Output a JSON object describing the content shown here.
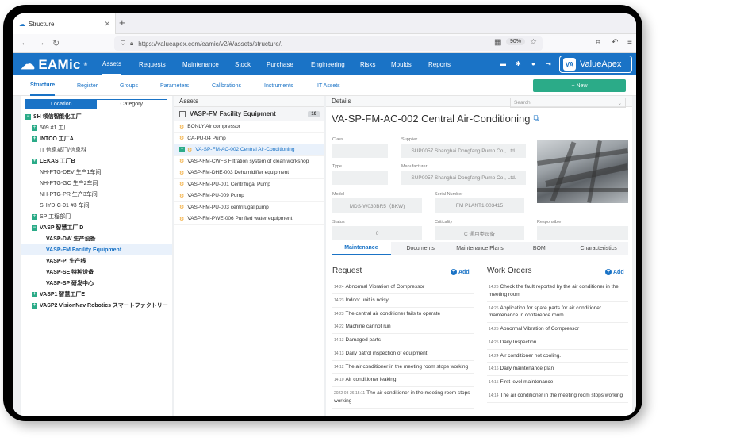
{
  "browser": {
    "tab_title": "Structure",
    "url": "https://valueapex.com/eamic/v2/#/assets/structure/.",
    "zoom": "90%"
  },
  "app": {
    "logo_text": "EAMic",
    "logo_reg": "®",
    "brand_right": "ValueApex",
    "brand_mark": "VA",
    "menu": [
      "Assets",
      "Requests",
      "Maintenance",
      "Stock",
      "Purchase",
      "Engineering",
      "Risks",
      "Moulds",
      "Reports"
    ]
  },
  "subnav": {
    "items": [
      "Structure",
      "Register",
      "Groups",
      "Parameters",
      "Calibrations",
      "Instruments",
      "IT Assets"
    ],
    "new_button": "+ New"
  },
  "locations": {
    "toggle": [
      "Location",
      "Category"
    ],
    "tree": [
      {
        "label": "SH 领信智能化工厂",
        "level": 0,
        "pm": "−",
        "bold": true
      },
      {
        "label": "509 #1 工厂",
        "level": 1,
        "pm": "+",
        "bold": false
      },
      {
        "label": "INTCO 工厂A",
        "level": 1,
        "pm": "+",
        "bold": true
      },
      {
        "label": "IT 信息部门/信息科",
        "level": 1,
        "pm": "",
        "bold": false
      },
      {
        "label": "LEKAS 工厂B",
        "level": 1,
        "pm": "+",
        "bold": true
      },
      {
        "label": "NH-PTG-DEV 生产1车间",
        "level": 1,
        "pm": "",
        "bold": false
      },
      {
        "label": "NH-PTG-GC 生产2车间",
        "level": 1,
        "pm": "",
        "bold": false
      },
      {
        "label": "NH-PTG-PR 生产3车间",
        "level": 1,
        "pm": "",
        "bold": false
      },
      {
        "label": "SHYD-C-01 #3 车间",
        "level": 1,
        "pm": "",
        "bold": false
      },
      {
        "label": "SP 工程部门",
        "level": 1,
        "pm": "+",
        "bold": false
      },
      {
        "label": "VASP 智慧工厂 D",
        "level": 1,
        "pm": "−",
        "bold": true
      },
      {
        "label": "VASP-DW 生产设备",
        "level": 2,
        "pm": "",
        "bold": true
      },
      {
        "label": "VASP-FM Facility Equipment",
        "level": 2,
        "pm": "",
        "bold": true,
        "selected": true
      },
      {
        "label": "VASP-PI 生产线",
        "level": 2,
        "pm": "",
        "bold": true
      },
      {
        "label": "VASP-SE 特种设备",
        "level": 2,
        "pm": "",
        "bold": true
      },
      {
        "label": "VASP-SP 研发中心",
        "level": 2,
        "pm": "",
        "bold": true
      },
      {
        "label": "VASP1 智慧工厂E",
        "level": 1,
        "pm": "+",
        "bold": true
      },
      {
        "label": "VASP2 VisionNav Robotics スマートファクトリー",
        "level": 1,
        "pm": "+",
        "bold": true
      }
    ]
  },
  "assets": {
    "header": "Assets",
    "group": "VASP-FM Facility Equipment",
    "count": "10",
    "items": [
      "BONLY Air compressor",
      "CA-PU-04 Pump",
      "VA-SP-FM-AC-002 Central Air-Conditioning",
      "VASP-FM-CWFS Filtration system of clean workshop",
      "VASP-FM-DHE-003 Dehumidifier equipment",
      "VASP-FM-PU-001 Centrifugal Pump",
      "VASP-FM-PU-009 Pump",
      "VASP-FM-PU-003 centrifugal pump",
      "VASP-FM-PWE-006 Purified water equipment"
    ]
  },
  "details": {
    "header": "Details",
    "search_placeholder": "Search",
    "title": "VA-SP-FM-AC-002 Central Air-Conditioning",
    "fields": {
      "class_label": "Class",
      "class_value": "",
      "supplier_label": "Supplier",
      "supplier_value": "SUP0057 Shanghai Dongfang Pump Co., Ltd.",
      "type_label": "Type",
      "type_value": "",
      "manufacturer_label": "Manufacturer",
      "manufacturer_value": "SUP0057 Shanghai Dongfang Pump Co., Ltd.",
      "model_label": "Model",
      "model_value": "MDS-W030BR5（BKW)",
      "serial_label": "Serial Number",
      "serial_value": "FM PLANT1 003415",
      "status_label": "Status",
      "status_value": "0",
      "criticality_label": "Criticality",
      "criticality_value": "C 通用类设备",
      "responsible_label": "Responsible",
      "responsible_value": ""
    },
    "tabs": [
      "Maintenance",
      "Documents",
      "Maintenance Plans",
      "BOM",
      "Characteristics"
    ],
    "request": {
      "title": "Request",
      "add": "Add",
      "items": [
        {
          "time": "14:24",
          "text": "Abnormal Vibration of Compressor"
        },
        {
          "time": "14:23",
          "text": "Indoor unit is noisy."
        },
        {
          "time": "14:23",
          "text": "The central air conditioner fails to operate"
        },
        {
          "time": "14:22",
          "text": "Machine cannot run"
        },
        {
          "time": "14:13",
          "text": "Damaged parts"
        },
        {
          "time": "14:13",
          "text": "Daily patrol inspection of equipment"
        },
        {
          "time": "14:12",
          "text": "The air conditioner in the meeting room stops working"
        },
        {
          "time": "14:10",
          "text": "Air conditioner leaking."
        },
        {
          "time": "2022-08-26 15:11",
          "text": "The air conditioner in the meeting room stops working"
        }
      ]
    },
    "work_orders": {
      "title": "Work Orders",
      "add": "Add",
      "items": [
        {
          "time": "14:26",
          "text": "Check the fault reported by the air conditioner in the meeting room"
        },
        {
          "time": "14:26",
          "text": "Application for spare parts for air conditioner maintenance in conference room"
        },
        {
          "time": "14:25",
          "text": "Abnormal Vibration of Compressor"
        },
        {
          "time": "14:25",
          "text": "Daily Inspection"
        },
        {
          "time": "14:24",
          "text": "Air conditioner not cooling."
        },
        {
          "time": "14:16",
          "text": "Daily maintenance plan"
        },
        {
          "time": "14:15",
          "text": "First level maintenance"
        },
        {
          "time": "14:14",
          "text": "The air conditioner in the meeting room stops working"
        }
      ]
    }
  },
  "colors": {
    "primary": "#1a73c6",
    "green": "#2bab88"
  }
}
